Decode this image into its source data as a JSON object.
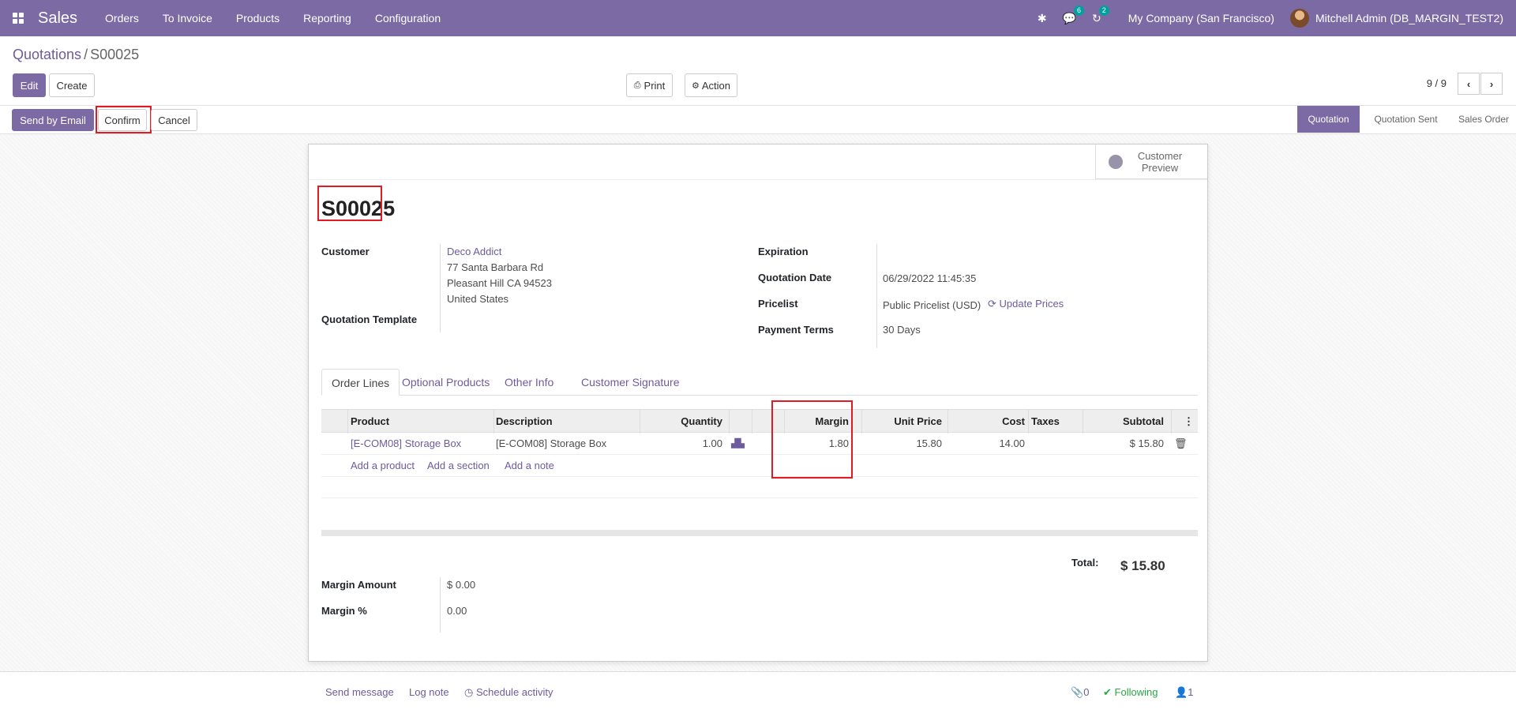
{
  "navbar": {
    "app": "Sales",
    "menu": [
      "Orders",
      "To Invoice",
      "Products",
      "Reporting",
      "Configuration"
    ],
    "messages_count": "6",
    "activity_count": "2",
    "company": "My Company (San Francisco)",
    "user": "Mitchell Admin (DB_MARGIN_TEST2)"
  },
  "breadcrumb": {
    "parent": "Quotations",
    "sep": "/",
    "current": "S00025"
  },
  "buttons": {
    "edit": "Edit",
    "create": "Create",
    "print": "Print",
    "action": "Action",
    "send_email": "Send by Email",
    "confirm": "Confirm",
    "cancel": "Cancel"
  },
  "pager": "9 / 9",
  "stages": [
    "Quotation",
    "Quotation Sent",
    "Sales Order"
  ],
  "preview": "Customer Preview",
  "order": {
    "name": "S00025",
    "customer_label": "Customer",
    "customer": "Deco Addict",
    "address": [
      "77 Santa Barbara Rd",
      "Pleasant Hill CA 94523",
      "United States"
    ],
    "template_label": "Quotation Template",
    "expiration_label": "Expiration",
    "date_label": "Quotation Date",
    "date": "06/29/2022 11:45:35",
    "pricelist_label": "Pricelist",
    "pricelist": "Public Pricelist (USD)",
    "update_prices": "Update Prices",
    "terms_label": "Payment Terms",
    "terms": "30 Days"
  },
  "tabs": [
    "Order Lines",
    "Optional Products",
    "Other Info",
    "Customer Signature"
  ],
  "table": {
    "headers": [
      "Product",
      "Description",
      "Quantity",
      "Margin",
      "Unit Price",
      "Cost",
      "Taxes",
      "Subtotal"
    ],
    "row": {
      "product": "[E-COM08] Storage Box",
      "description": "[E-COM08] Storage Box",
      "quantity": "1.00",
      "margin": "1.80",
      "unit_price": "15.80",
      "cost": "14.00",
      "taxes": "",
      "subtotal": "$ 15.80"
    },
    "add_product": "Add a product",
    "add_section": "Add a section",
    "add_note": "Add a note"
  },
  "totals": {
    "total_label": "Total:",
    "total": "$ 15.80",
    "margin_amount_label": "Margin Amount",
    "margin_amount": "$ 0.00",
    "margin_pct_label": "Margin %",
    "margin_pct": "0.00"
  },
  "chatter": {
    "send_message": "Send message",
    "log_note": "Log note",
    "schedule": "Schedule activity",
    "attachments": "0",
    "following": "Following",
    "followers": "1"
  },
  "colors": {
    "brand": "#7C6AA5",
    "link": "#6d5b9d",
    "highlight": "#e01b24"
  }
}
